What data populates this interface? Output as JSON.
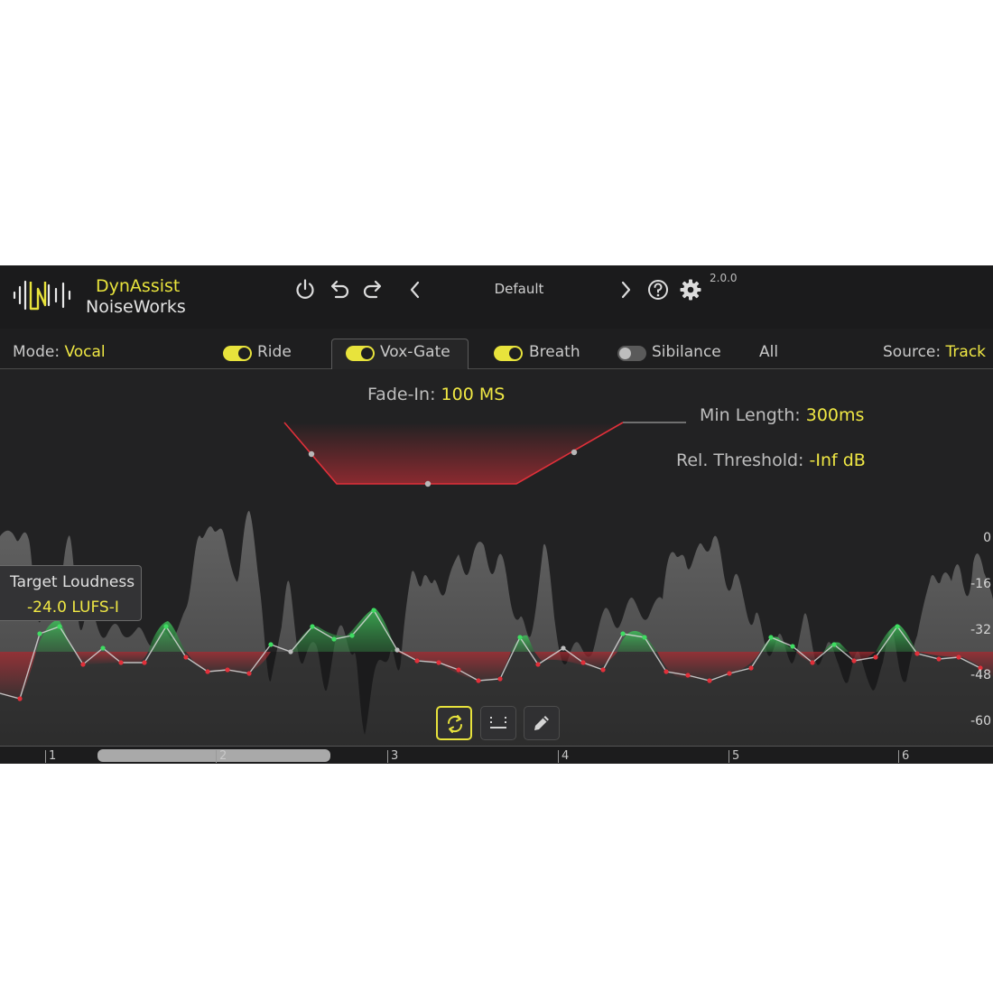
{
  "header": {
    "brand_top": "DynAssist",
    "brand_bottom": "NoiseWorks",
    "preset": "Default",
    "version": "2.0.0",
    "icons": [
      "power-icon",
      "undo-icon",
      "redo-icon",
      "chevron-left-icon",
      "chevron-right-icon",
      "help-icon",
      "gear-icon"
    ]
  },
  "modebar": {
    "mode_label": "Mode:",
    "mode_value": "Vocal",
    "modules": [
      {
        "label": "Ride",
        "enabled": true
      },
      {
        "label": "Vox-Gate",
        "enabled": true,
        "active_tab": true
      },
      {
        "label": "Breath",
        "enabled": true
      },
      {
        "label": "Sibilance",
        "enabled": false
      }
    ],
    "all_label": "All",
    "source_label": "Source:",
    "source_value": "Track"
  },
  "gate": {
    "fade_in_label": "Fade-In:",
    "fade_in_value": "100 MS",
    "min_length_label": "Min Length:",
    "min_length_value": "300ms",
    "rel_threshold_label": "Rel. Threshold:",
    "rel_threshold_value": "-Inf dB"
  },
  "display": {
    "db_scale": [
      "0",
      "-16",
      "-32",
      "-48",
      "-60"
    ],
    "target_title": "Target Loudness",
    "target_value": "-24.0 LUFS-I",
    "ruler_marks": [
      "1",
      "2",
      "3",
      "4",
      "5",
      "6"
    ],
    "tools": [
      "loop-icon",
      "grid-icon",
      "pencil-icon"
    ]
  },
  "colors": {
    "accent": "#e8e33c",
    "boost": "#3fbf5a",
    "cut": "#e0303a",
    "background": "#222223"
  }
}
